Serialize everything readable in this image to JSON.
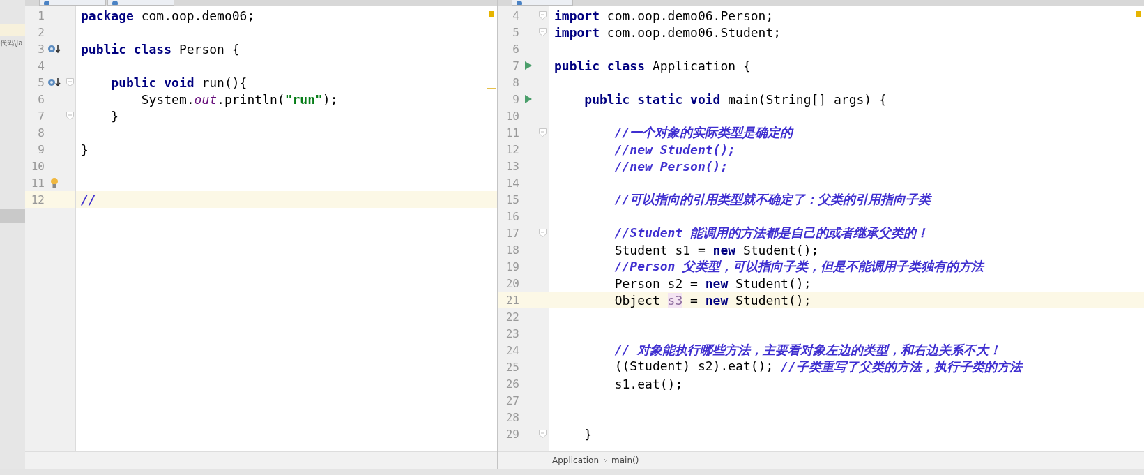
{
  "sidebar": {
    "path": "代码\\Ja"
  },
  "panes": [
    {
      "tabs": [
        {
          "kind": "java"
        },
        {
          "kind": "java"
        }
      ],
      "lines": [
        {
          "number": "1",
          "current": false,
          "tokens": [
            {
              "text": "package",
              "kind": "keyword"
            },
            {
              "text": " com.oop.demo06;",
              "kind": "plain"
            }
          ]
        },
        {
          "number": "2",
          "current": false
        },
        {
          "number": "3",
          "current": false,
          "markers": [
            {
              "kind": "override"
            }
          ],
          "tokens": [
            {
              "text": "public class",
              "kind": "keyword"
            },
            {
              "text": " Person {",
              "kind": "plain"
            }
          ]
        },
        {
          "number": "4",
          "current": false
        },
        {
          "number": "5",
          "current": false,
          "markers": [
            {
              "kind": "override"
            },
            {
              "kind": "fold"
            }
          ],
          "tokens": [
            {
              "text": "    public void",
              "kind": "keyword"
            },
            {
              "text": " run(){",
              "kind": "plain"
            }
          ]
        },
        {
          "number": "6",
          "current": false,
          "tokens": [
            {
              "text": "        System.",
              "kind": "plain"
            },
            {
              "text": "out",
              "kind": "field"
            },
            {
              "text": ".println(",
              "kind": "plain"
            },
            {
              "text": "\"run\"",
              "kind": "string"
            },
            {
              "text": ");",
              "kind": "plain"
            }
          ]
        },
        {
          "number": "7",
          "current": false,
          "markers": [
            {
              "kind": "fold"
            }
          ],
          "tokens": [
            {
              "text": "    }",
              "kind": "plain"
            }
          ]
        },
        {
          "number": "8",
          "current": false
        },
        {
          "number": "9",
          "current": false,
          "tokens": [
            {
              "text": "}",
              "kind": "plain"
            }
          ]
        },
        {
          "number": "10",
          "current": false
        },
        {
          "number": "11",
          "current": false,
          "markers": [
            {
              "kind": "bulb"
            }
          ]
        },
        {
          "number": "12",
          "current": true,
          "tokens": [
            {
              "text": "//",
              "kind": "comment"
            }
          ]
        }
      ]
    },
    {
      "tabs": [
        {
          "kind": "java"
        }
      ],
      "lines": [
        {
          "number": "4",
          "current": false,
          "markers": [
            {
              "kind": "fold"
            }
          ],
          "tokens": [
            {
              "text": "import",
              "kind": "keyword"
            },
            {
              "text": " com.oop.demo06.Person;",
              "kind": "plain"
            }
          ]
        },
        {
          "number": "5",
          "current": false,
          "markers": [
            {
              "kind": "fold"
            }
          ],
          "tokens": [
            {
              "text": "import",
              "kind": "keyword"
            },
            {
              "text": " com.oop.demo06.Student;",
              "kind": "plain"
            }
          ]
        },
        {
          "number": "6",
          "current": false
        },
        {
          "number": "7",
          "current": false,
          "markers": [
            {
              "kind": "run"
            }
          ],
          "tokens": [
            {
              "text": "public class",
              "kind": "keyword"
            },
            {
              "text": " Application {",
              "kind": "plain"
            }
          ]
        },
        {
          "number": "8",
          "current": false
        },
        {
          "number": "9",
          "current": false,
          "markers": [
            {
              "kind": "run"
            }
          ],
          "tokens": [
            {
              "text": "    public static void",
              "kind": "keyword"
            },
            {
              "text": " main(String[] args) {",
              "kind": "plain"
            }
          ]
        },
        {
          "number": "10",
          "current": false
        },
        {
          "number": "11",
          "current": false,
          "markers": [
            {
              "kind": "fold"
            }
          ],
          "tokens": [
            {
              "text": "        //一个对象的实际类型是确定的",
              "kind": "comment"
            }
          ]
        },
        {
          "number": "12",
          "current": false,
          "tokens": [
            {
              "text": "        //new Student();",
              "kind": "comment"
            }
          ]
        },
        {
          "number": "13",
          "current": false,
          "tokens": [
            {
              "text": "        //new Person();",
              "kind": "comment"
            }
          ]
        },
        {
          "number": "14",
          "current": false
        },
        {
          "number": "15",
          "current": false,
          "tokens": [
            {
              "text": "        //可以指向的引用类型就不确定了：父类的引用指向子类",
              "kind": "comment"
            }
          ]
        },
        {
          "number": "16",
          "current": false
        },
        {
          "number": "17",
          "current": false,
          "markers": [
            {
              "kind": "fold"
            }
          ],
          "tokens": [
            {
              "text": "        //Student 能调用的方法都是自己的或者继承父类的！",
              "kind": "comment"
            }
          ]
        },
        {
          "number": "18",
          "current": false,
          "tokens": [
            {
              "text": "        Student s1 = ",
              "kind": "plain"
            },
            {
              "text": "new",
              "kind": "keyword"
            },
            {
              "text": " Student();",
              "kind": "plain"
            }
          ]
        },
        {
          "number": "19",
          "current": false,
          "tokens": [
            {
              "text": "        //Person 父类型，可以指向子类，但是不能调用子类独有的方法",
              "kind": "comment"
            }
          ]
        },
        {
          "number": "20",
          "current": false,
          "tokens": [
            {
              "text": "        Person s2 = ",
              "kind": "plain"
            },
            {
              "text": "new",
              "kind": "keyword"
            },
            {
              "text": " Student();",
              "kind": "plain"
            }
          ]
        },
        {
          "number": "21",
          "current": true,
          "tokens": [
            {
              "text": "        Object ",
              "kind": "plain"
            },
            {
              "text": "s3",
              "kind": "unused"
            },
            {
              "text": " = ",
              "kind": "plain"
            },
            {
              "text": "new",
              "kind": "keyword"
            },
            {
              "text": " Student();",
              "kind": "plain"
            }
          ]
        },
        {
          "number": "22",
          "current": false
        },
        {
          "number": "23",
          "current": false
        },
        {
          "number": "24",
          "current": false,
          "tokens": [
            {
              "text": "        // 对象能执行哪些方法，主要看对象左边的类型，和右边关系不大！",
              "kind": "comment"
            }
          ]
        },
        {
          "number": "25",
          "current": false,
          "tokens": [
            {
              "text": "        ((Student) s2).eat(); ",
              "kind": "plain"
            },
            {
              "text": "//子类重写了父类的方法，执行子类的方法",
              "kind": "comment"
            }
          ]
        },
        {
          "number": "26",
          "current": false,
          "tokens": [
            {
              "text": "        s1.eat();",
              "kind": "plain"
            }
          ]
        },
        {
          "number": "27",
          "current": false
        },
        {
          "number": "28",
          "current": false
        },
        {
          "number": "29",
          "current": false,
          "markers": [
            {
              "kind": "fold"
            }
          ],
          "tokens": [
            {
              "text": "    }",
              "kind": "plain"
            }
          ]
        }
      ],
      "breadcrumbs": [
        "Application",
        "main()"
      ]
    }
  ]
}
